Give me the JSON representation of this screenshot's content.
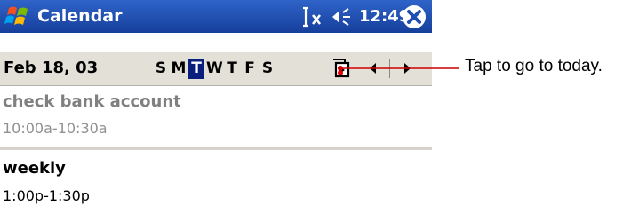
{
  "titlebar": {
    "app_title": "Calendar",
    "clock": "12:49",
    "icons": [
      "windows-start-icon",
      "sync-icon",
      "speaker-icon",
      "close-icon"
    ],
    "color": "#1f4fb3"
  },
  "datebar": {
    "date": "Feb 18, 03",
    "days": [
      "S",
      "M",
      "T",
      "W",
      "T",
      "F",
      "S"
    ],
    "active_day_index": 2,
    "icons": [
      "go-to-today-icon",
      "prev-arrow-icon",
      "next-arrow-icon"
    ]
  },
  "appointments": [
    {
      "title": "check bank account",
      "time": "10:00a-10:30a"
    },
    {
      "title": "weekly",
      "time": "1:00p-1:30p"
    }
  ],
  "callout": {
    "text": "Tap to go to today.",
    "color": "#cc0000"
  }
}
